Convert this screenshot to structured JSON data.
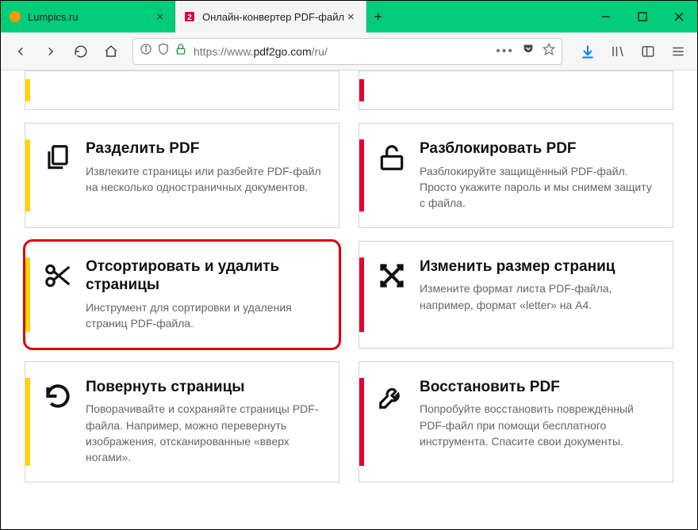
{
  "window": {
    "tabs": [
      {
        "title": "Lumpics.ru",
        "active": false,
        "favicon": "orange-circle"
      },
      {
        "title": "Онлайн-конвертер PDF-файл",
        "active": true,
        "favicon": "pdf2go"
      }
    ]
  },
  "url": {
    "prefix": "https://www.",
    "host": "pdf2go.com",
    "path": "/ru/",
    "lock": true,
    "shield": true
  },
  "cards": [
    {
      "stripe": "yellow",
      "icon": "",
      "title": "",
      "desc": "",
      "stub": true
    },
    {
      "stripe": "red",
      "icon": "",
      "title": "",
      "desc": "",
      "stub": true
    },
    {
      "stripe": "yellow",
      "icon": "copy",
      "title": "Разделить PDF",
      "desc": "Извлеките страницы или разбейте PDF-файл на несколько одностраничных документов."
    },
    {
      "stripe": "red",
      "icon": "unlock",
      "title": "Разблокировать PDF",
      "desc": "Разблокируйте защищённый PDF-файл. Просто укажите пароль и мы снимем защиту с файла."
    },
    {
      "stripe": "yellow",
      "icon": "scissors",
      "title": "Отсортировать и удалить страницы",
      "desc": "Инструмент для сортировки и удаления страниц PDF-файла.",
      "highlighted": true
    },
    {
      "stripe": "red",
      "icon": "expand",
      "title": "Изменить размер страниц",
      "desc": "Измените формат листа PDF-файла, например, формат «letter» на A4."
    },
    {
      "stripe": "yellow",
      "icon": "rotate",
      "title": "Повернуть страницы",
      "desc": "Поворачивайте и сохраняйте страницы PDF-файла. Например, можно перевернуть изображения, отсканированные «вверх ногами»."
    },
    {
      "stripe": "red",
      "icon": "wrench",
      "title": "Восстановить PDF",
      "desc": "Попробуйте восстановить повреждённый PDF-файл при помощи бесплатного инструмента. Спасите свои документы."
    }
  ]
}
